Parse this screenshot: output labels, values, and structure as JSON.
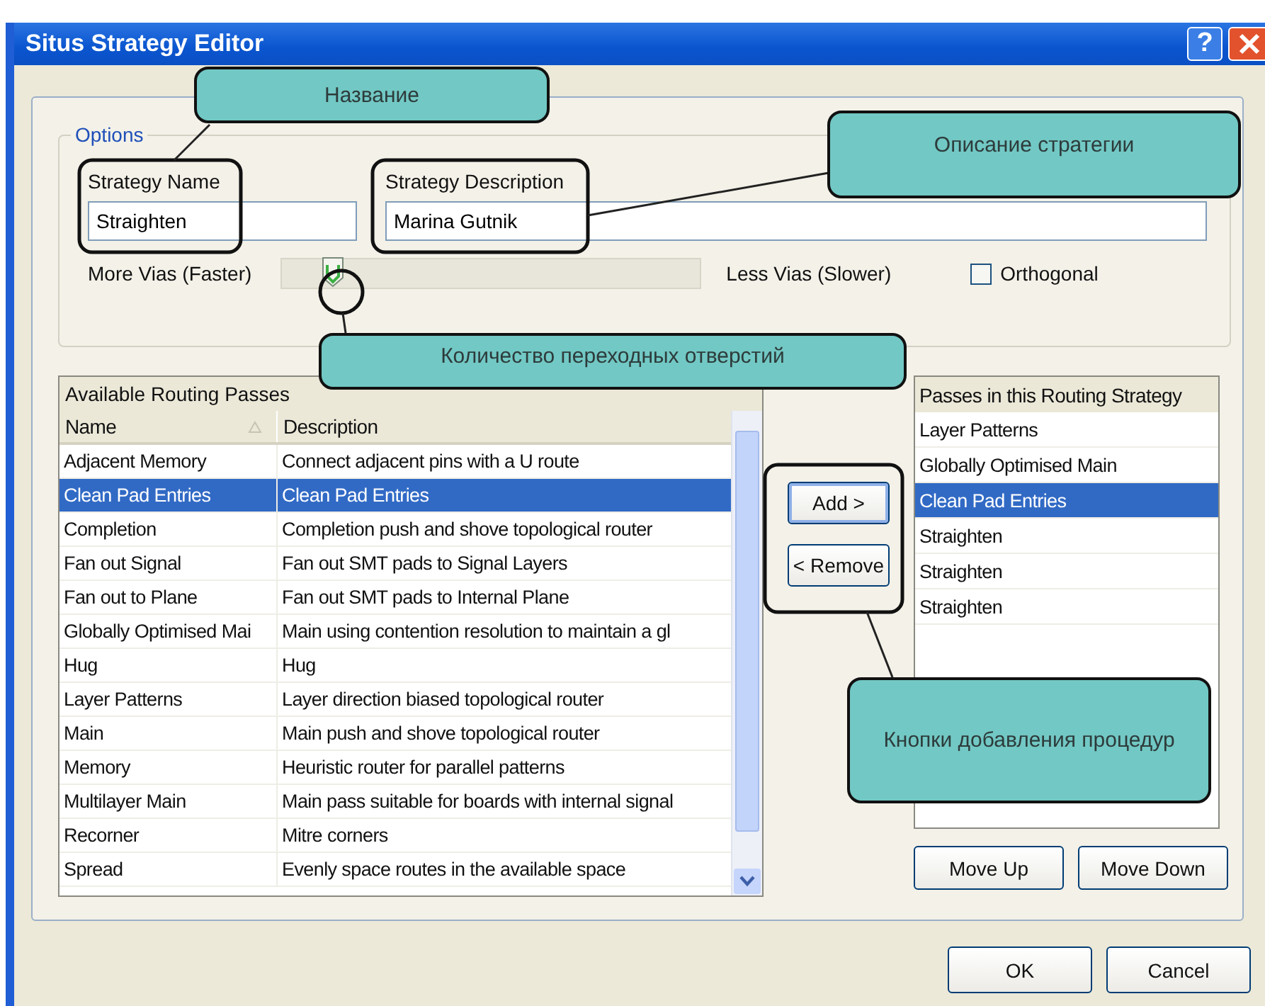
{
  "window": {
    "title": "Situs Strategy Editor",
    "help": "?"
  },
  "options": {
    "group_label": "Options",
    "strategy_name": {
      "label": "Strategy Name",
      "value": "Straighten"
    },
    "strategy_description": {
      "label": "Strategy Description",
      "value": "Marina Gutnik"
    },
    "via_slider": {
      "left_label": "More Vias (Faster)",
      "right_label": "Less Vias (Slower)",
      "level": 0.1
    },
    "orthogonal": {
      "label": "Orthogonal",
      "checked": false
    }
  },
  "available_passes": {
    "title": "Available Routing Passes",
    "columns": [
      "Name",
      "Description"
    ],
    "rows": [
      {
        "name": "Adjacent Memory",
        "description": "Connect adjacent pins with a U route",
        "selected": false
      },
      {
        "name": "Clean Pad Entries",
        "description": "Clean Pad Entries",
        "selected": true
      },
      {
        "name": "Completion",
        "description": "Completion push and shove topological router",
        "selected": false
      },
      {
        "name": "Fan out Signal",
        "description": "Fan out SMT pads to Signal Layers",
        "selected": false
      },
      {
        "name": "Fan out to Plane",
        "description": "Fan out SMT pads to Internal Plane",
        "selected": false
      },
      {
        "name": "Globally Optimised Mai",
        "description": "Main using contention resolution to maintain a gl",
        "selected": false
      },
      {
        "name": "Hug",
        "description": "Hug",
        "selected": false
      },
      {
        "name": "Layer Patterns",
        "description": "Layer direction biased topological router",
        "selected": false
      },
      {
        "name": "Main",
        "description": "Main push and shove topological router",
        "selected": false
      },
      {
        "name": "Memory",
        "description": "Heuristic router for parallel patterns",
        "selected": false
      },
      {
        "name": "Multilayer Main",
        "description": "Main pass suitable for boards with internal signal",
        "selected": false
      },
      {
        "name": "Recorner",
        "description": "Mitre corners",
        "selected": false
      },
      {
        "name": "Spread",
        "description": "Evenly space routes in the available space",
        "selected": false
      }
    ]
  },
  "transfer_buttons": [
    {
      "label": "Add >",
      "default": true
    },
    {
      "label": "< Remove",
      "default": false
    }
  ],
  "strategy_passes": {
    "title": "Passes in this Routing Strategy",
    "items": [
      {
        "label": "Layer Patterns",
        "selected": false
      },
      {
        "label": "Globally Optimised Main",
        "selected": false
      },
      {
        "label": "Clean Pad Entries",
        "selected": true
      },
      {
        "label": "Straighten",
        "selected": false
      },
      {
        "label": "Straighten",
        "selected": false
      },
      {
        "label": "Straighten",
        "selected": false
      }
    ]
  },
  "order_buttons": [
    {
      "label": "Move Up"
    },
    {
      "label": "Move Down"
    }
  ],
  "dialog_buttons": [
    {
      "label": "OK"
    },
    {
      "label": "Cancel"
    }
  ],
  "annotations": [
    {
      "text": "Название"
    },
    {
      "text": "Описание стратегии"
    },
    {
      "text": "Количество переходных отверстий"
    },
    {
      "text": "Кнопки добавления процедур"
    }
  ]
}
